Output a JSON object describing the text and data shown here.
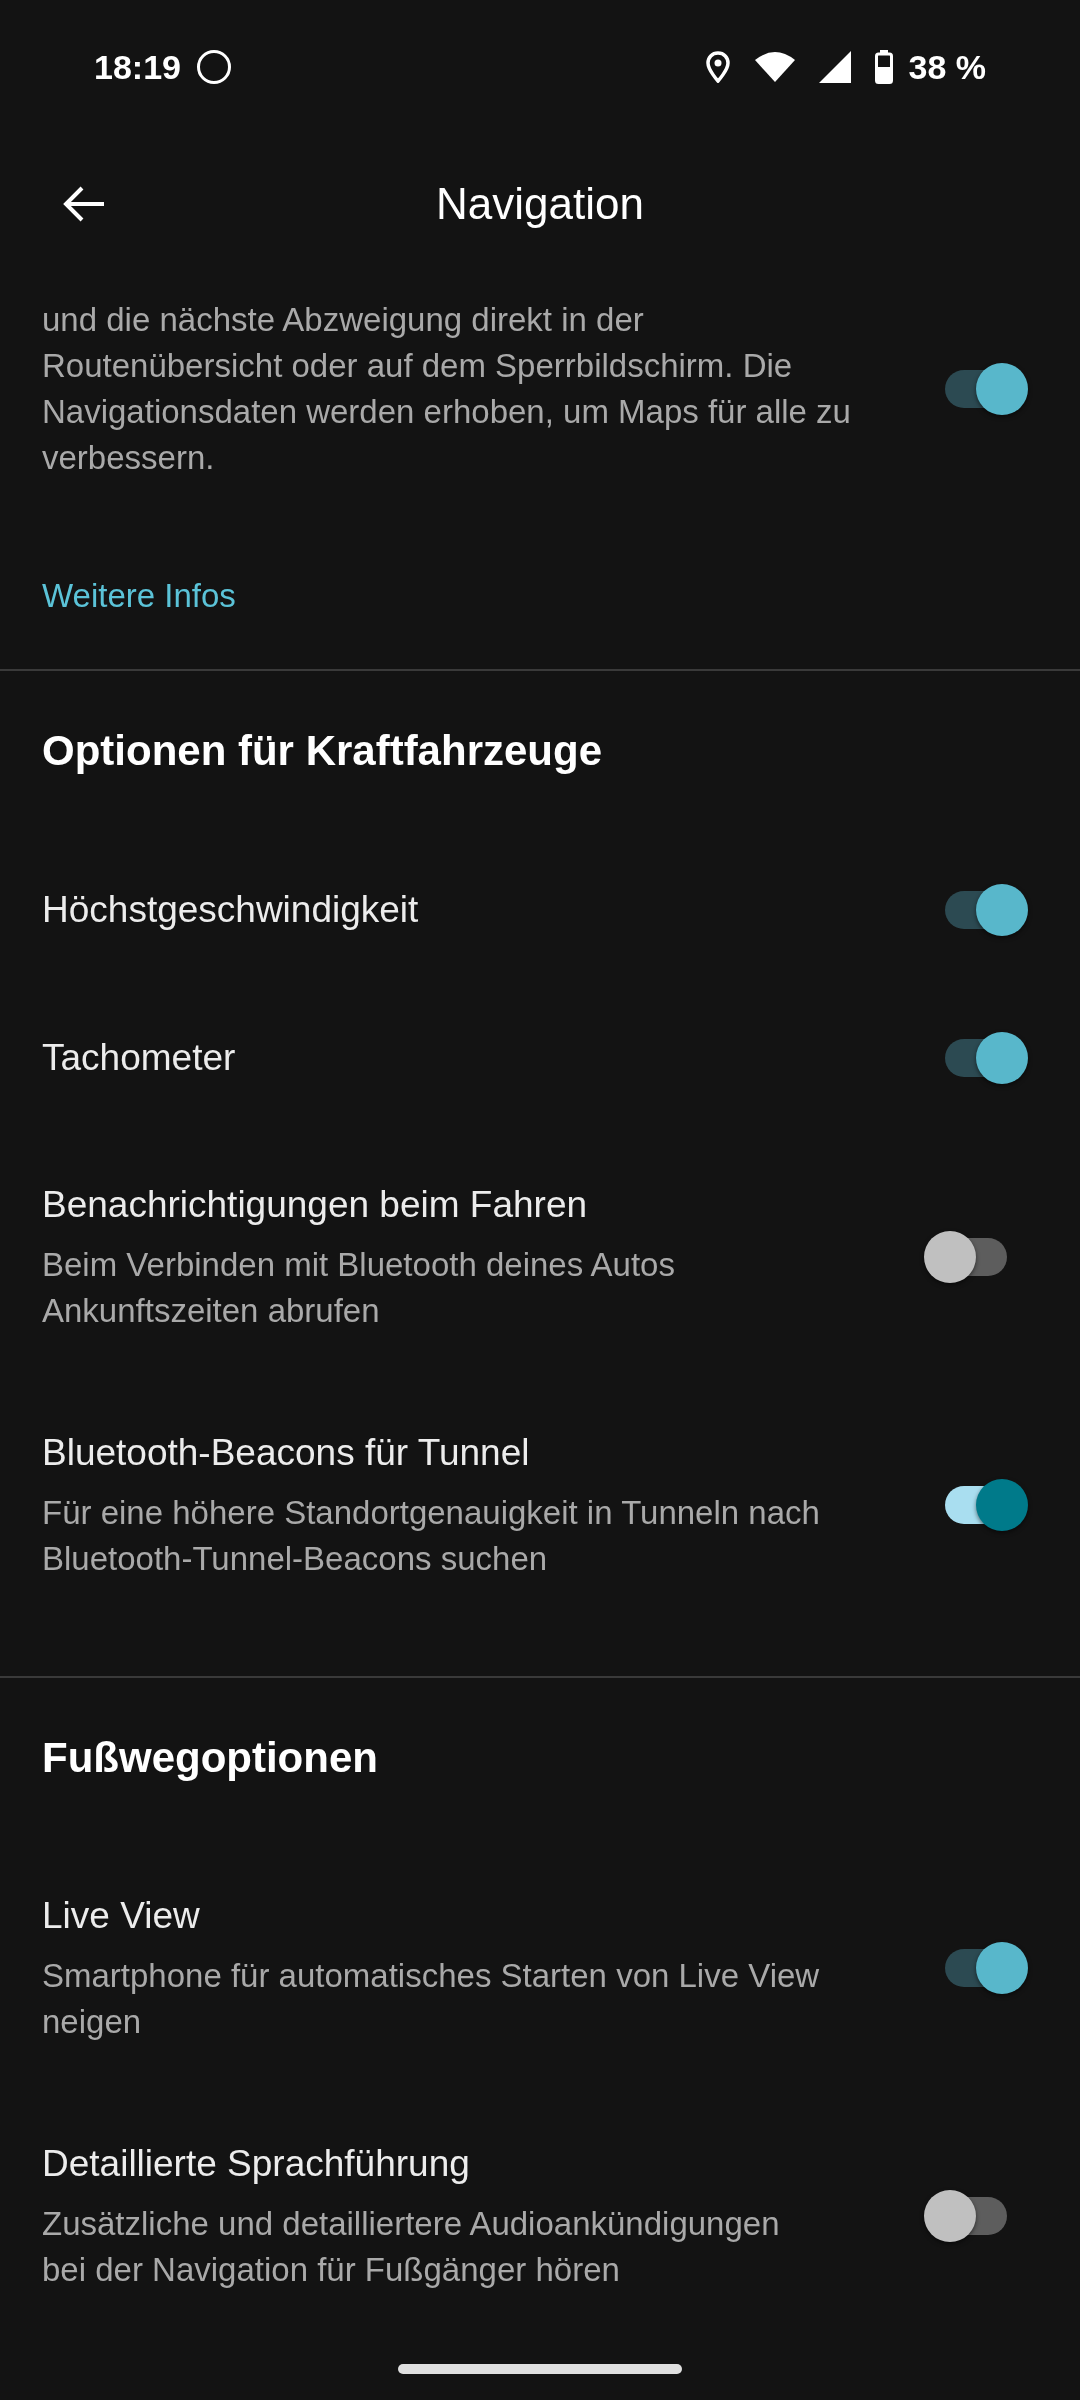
{
  "status_bar": {
    "time": "18:19",
    "battery": "38 %"
  },
  "app_bar": {
    "title": "Navigation"
  },
  "intro": {
    "description": "und die nächste Abzweigung direkt in der Routenübersicht oder auf dem Sperrbildschirm. Die Navigationsdaten werden erhoben, um Maps für alle zu verbessern.",
    "on": true,
    "highlighted": false,
    "link": "Weitere Infos"
  },
  "sections": [
    {
      "title": "Optionen für Kraftfahrzeuge",
      "items": [
        {
          "title": "Höchstgeschwindigkeit",
          "on": true,
          "highlighted": false
        },
        {
          "title": "Tachometer",
          "on": true,
          "highlighted": false
        },
        {
          "title": "Benachrichtigungen beim Fahren",
          "description": "Beim Verbinden mit Bluetooth deines Autos Ankunftszeiten abrufen",
          "on": false,
          "highlighted": false
        },
        {
          "title": "Bluetooth-Beacons für Tunnel",
          "description": "Für eine höhere Standortgenauigkeit in Tunneln nach Bluetooth-Tunnel-Beacons suchen",
          "on": true,
          "highlighted": true
        }
      ]
    },
    {
      "title": "Fußwegoptionen",
      "items": [
        {
          "title": "Live View",
          "description": "Smartphone für automatisches Starten von Live View neigen",
          "on": true,
          "highlighted": false
        },
        {
          "title": "Detaillierte Sprachführung",
          "description": "Zusätzliche und detailliertere Audioankündigungen bei der Navigation für Fußgänger hören",
          "on": false,
          "highlighted": false
        }
      ]
    }
  ]
}
